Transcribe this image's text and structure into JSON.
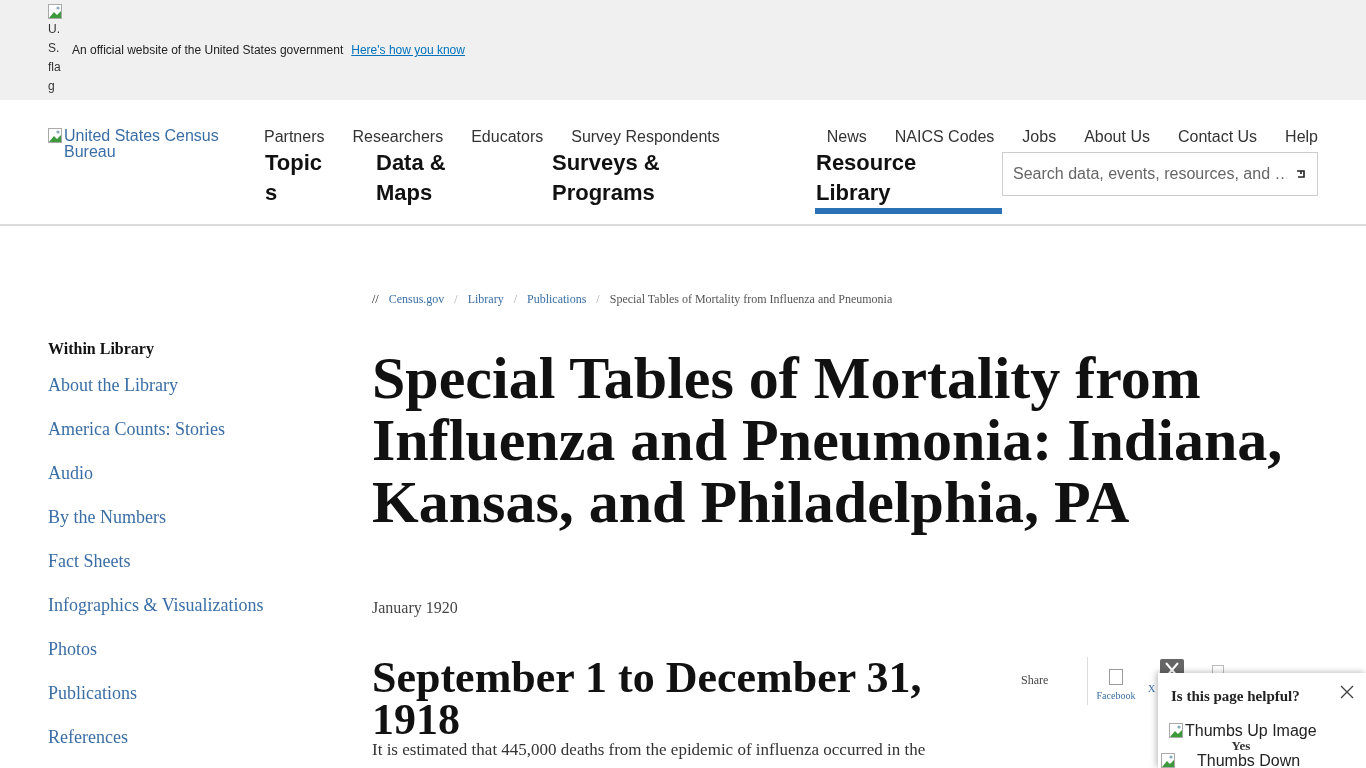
{
  "gov_banner": {
    "flag_alt": "U.S. flag",
    "text": "An official website of the United States government",
    "link": "Here's how you know"
  },
  "header": {
    "logo_alt": "United States Census Bureau",
    "audience_links": [
      "Partners",
      "Researchers",
      "Educators",
      "Survey Respondents"
    ],
    "utility_links": [
      "News",
      "NAICS Codes",
      "Jobs",
      "About Us",
      "Contact Us",
      "Help"
    ],
    "main_nav": [
      {
        "label": "Topics",
        "selected": false
      },
      {
        "label": "Data & Maps",
        "selected": false
      },
      {
        "label": "Surveys & Programs",
        "selected": false
      },
      {
        "label": "Resource Library",
        "selected": true
      }
    ],
    "search": {
      "placeholder": "Search data, events, resources, and …"
    }
  },
  "sidebar": {
    "heading": "Within Library",
    "items": [
      "About the Library",
      "America Counts: Stories",
      "Audio",
      "By the Numbers",
      "Fact Sheets",
      "Infographics & Visualizations",
      "Photos",
      "Publications",
      "References"
    ]
  },
  "breadcrumb": {
    "separator_mark": "//",
    "items": [
      {
        "label": "Census.gov",
        "kind": "link"
      },
      {
        "separator": "/",
        "label": "Library",
        "kind": "link"
      },
      {
        "separator": "/",
        "label": "Publications",
        "kind": "link"
      },
      {
        "separator": "/",
        "label": "Special Tables of Mortality from Influenza and Pneumonia",
        "kind": "current"
      }
    ]
  },
  "article": {
    "title": "Special Tables of Mortality from Influenza and Pneumonia: Indiana, Kansas, and Philadelphia, PA",
    "date": "January 1920",
    "subheading": "September 1 to December 31, 1918",
    "paragraph": "It is estimated that 445,000 deaths from the epidemic of influenza occurred in the"
  },
  "share": {
    "label": "Share",
    "items": [
      {
        "kind": "facebook",
        "label": "Facebook"
      },
      {
        "kind": "x",
        "label": "X"
      },
      {
        "kind": "other"
      }
    ]
  },
  "feedback": {
    "title": "Is this page helpful?",
    "yes_image_alt": "Thumbs Up Image",
    "yes_label": "Yes",
    "no_image_alt": "Thumbs Down"
  }
}
